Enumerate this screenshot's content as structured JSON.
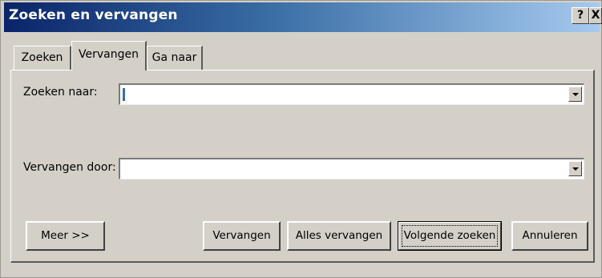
{
  "window": {
    "title": "Zoeken en vervangen",
    "help_label": "?",
    "close_label": "X"
  },
  "tabs": [
    {
      "label": "Zoeken",
      "active": false
    },
    {
      "label": "Vervangen",
      "active": true
    },
    {
      "label": "Ga naar",
      "active": false
    }
  ],
  "fields": {
    "find_label": "Zoeken naar:",
    "find_value": "",
    "replace_label": "Vervangen door:",
    "replace_value": ""
  },
  "buttons": {
    "more": "Meer >>",
    "replace": "Vervangen",
    "replace_all": "Alles vervangen",
    "find_next": "Volgende zoeken",
    "cancel": "Annuleren"
  },
  "colors": {
    "titlebar_start": "#0a246a",
    "titlebar_end": "#a6caf0",
    "dialog_face": "#d4d0c8"
  }
}
